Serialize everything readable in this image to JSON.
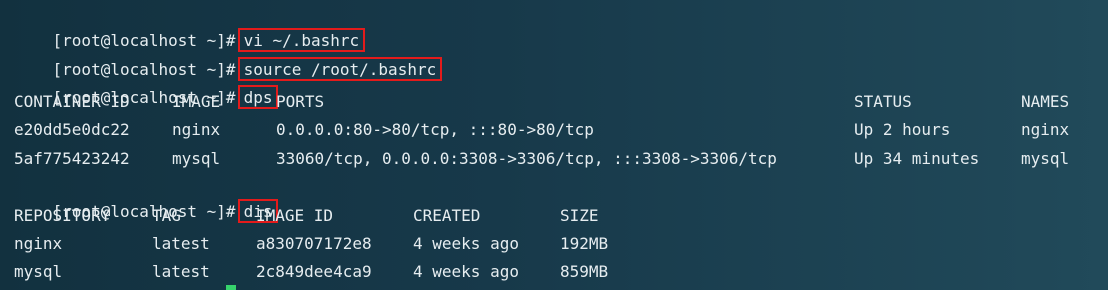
{
  "terminal": {
    "prompt": "[root@localhost ~]#",
    "commands": [
      "vi ~/.bashrc",
      "source /root/.bashrc",
      "dps",
      "dis"
    ],
    "ps": {
      "headers": [
        "CONTAINER ID",
        "IMAGE",
        "PORTS",
        "STATUS",
        "NAMES"
      ],
      "rows": [
        [
          "e20dd5e0dc22",
          "nginx",
          "0.0.0.0:80->80/tcp, :::80->80/tcp",
          "Up 2 hours",
          "nginx"
        ],
        [
          "5af775423242",
          "mysql",
          "33060/tcp, 0.0.0.0:3308->3306/tcp, :::3308->3306/tcp",
          "Up 34 minutes",
          "mysql"
        ]
      ]
    },
    "images": {
      "headers": [
        "REPOSITORY",
        "TAG",
        "IMAGE ID",
        "CREATED",
        "SIZE"
      ],
      "rows": [
        [
          "nginx",
          "latest",
          "a830707172e8",
          "4 weeks ago",
          "192MB"
        ],
        [
          "mysql",
          "latest",
          "2c849dee4ca9",
          "4 weeks ago",
          "859MB"
        ]
      ]
    },
    "colors": {
      "highlight_border": "#e31b1b",
      "cursor": "#36d36c",
      "text": "#e6edf0"
    }
  }
}
